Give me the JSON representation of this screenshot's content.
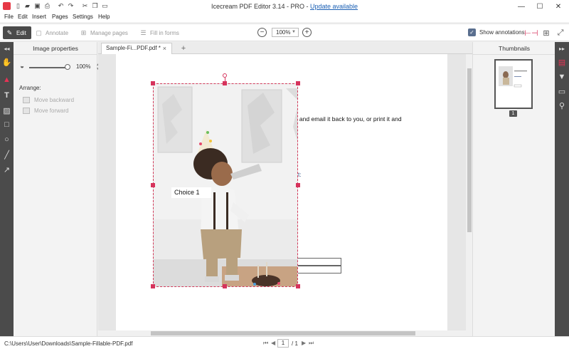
{
  "window": {
    "title_prefix": "Icecream PDF Editor 3.14 - PRO - ",
    "update_link": "Update available"
  },
  "menu": [
    "File",
    "Edit",
    "Insert",
    "Pages",
    "Settings",
    "Help"
  ],
  "toolbar": {
    "modes": {
      "edit": "Edit",
      "annotate": "Annotate",
      "manage_pages": "Manage pages",
      "fill_forms": "Fill in forms"
    },
    "zoom_value": "100%",
    "show_annotations_label": "Show annotations",
    "show_annotations_checked": true
  },
  "props_panel": {
    "title": "Image properties",
    "opacity_value": "100%",
    "opacity_fraction": 1.0,
    "arrange_label": "Arrange:",
    "move_backward": "Move backward",
    "move_forward": "Move forward"
  },
  "tabs": {
    "active_label": "Sample-Fi...PDF.pdf *",
    "close_glyph": "×",
    "new_tab_glyph": "+"
  },
  "document": {
    "visible_texts": {
      "line1": "save it and email it back to you, or print it and",
      "line2": "own list:"
    },
    "choice_field_value": "Choice 1"
  },
  "thumbnails": {
    "title": "Thumbnails",
    "page_number": "1"
  },
  "status": {
    "file_path": "C:\\Users\\User\\Downloads\\Sample-Fillable-PDF.pdf",
    "current_page": "1",
    "total_pages": "/ 1"
  },
  "colors": {
    "accent": "#d6335c",
    "dark_rail": "#4b4b4b",
    "link": "#1a5fb4"
  }
}
